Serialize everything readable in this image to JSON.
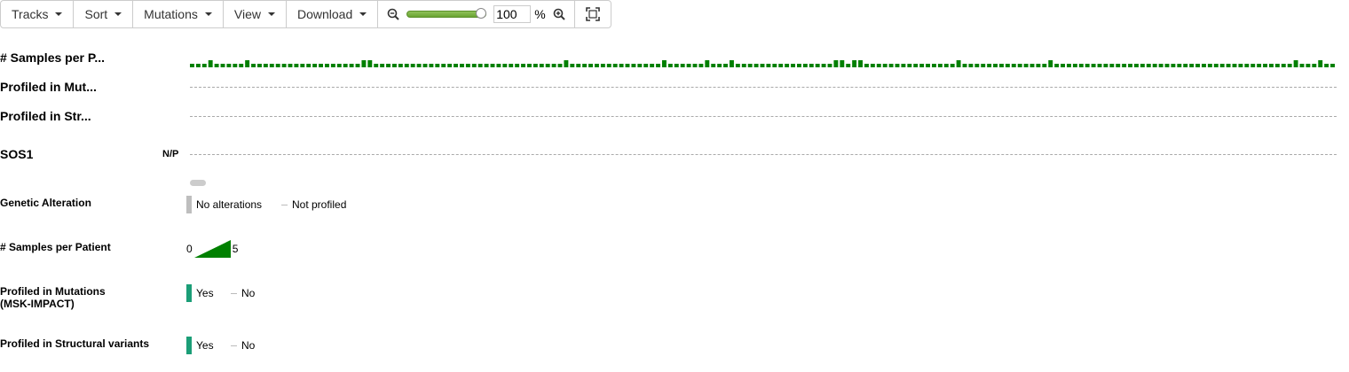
{
  "toolbar": {
    "tracks": "Tracks",
    "sort": "Sort",
    "mutations": "Mutations",
    "view": "View",
    "download": "Download",
    "zoom_value": "100",
    "zoom_unit": "%",
    "zoom_level": 1.0
  },
  "tracks": {
    "samples_per_patient": "# Samples per P...",
    "profiled_mutations": "Profiled in Mut...",
    "profiled_structural": "Profiled in Str...",
    "gene": "SOS1",
    "gene_status": "N/P"
  },
  "samples_per_patient_counts": [
    1,
    1,
    1,
    2,
    1,
    1,
    1,
    1,
    1,
    2,
    1,
    1,
    1,
    1,
    1,
    1,
    1,
    1,
    1,
    1,
    1,
    1,
    1,
    1,
    1,
    1,
    1,
    1,
    2,
    2,
    1,
    1,
    1,
    1,
    1,
    1,
    1,
    1,
    1,
    1,
    1,
    1,
    1,
    1,
    1,
    1,
    1,
    1,
    1,
    1,
    1,
    1,
    1,
    1,
    1,
    1,
    1,
    1,
    1,
    1,
    1,
    2,
    1,
    1,
    1,
    1,
    1,
    1,
    1,
    1,
    1,
    1,
    1,
    1,
    1,
    1,
    1,
    2,
    1,
    1,
    1,
    1,
    1,
    1,
    2,
    1,
    1,
    1,
    2,
    1,
    1,
    1,
    1,
    1,
    1,
    1,
    1,
    1,
    1,
    1,
    1,
    1,
    1,
    1,
    1,
    2,
    2,
    1,
    2,
    2,
    1,
    1,
    1,
    1,
    1,
    1,
    1,
    1,
    1,
    1,
    1,
    1,
    1,
    1,
    1,
    2,
    1,
    1,
    1,
    1,
    1,
    1,
    1,
    1,
    1,
    1,
    1,
    1,
    1,
    1,
    2,
    1,
    1,
    1,
    1,
    1,
    1,
    1,
    1,
    1,
    1,
    1,
    1,
    1,
    1,
    1,
    1,
    1,
    1,
    1,
    1,
    1,
    1,
    1,
    1,
    1,
    1,
    1,
    1,
    1,
    1,
    1,
    1,
    1,
    1,
    1,
    1,
    1,
    1,
    1,
    2,
    1,
    1,
    1,
    2,
    1,
    1
  ],
  "legend": {
    "genetic_alteration": {
      "label": "Genetic Alteration",
      "no_alterations": "No alterations",
      "not_profiled": "Not profiled",
      "no_alt_color": "#bebebe"
    },
    "samples_per_patient": {
      "label": "# Samples per Patient",
      "min": "0",
      "max": "5",
      "color": "#008000"
    },
    "profiled_mutations": {
      "label_line1": "Profiled in Mutations",
      "label_line2": "(MSK-IMPACT)",
      "yes": "Yes",
      "no": "No",
      "color": "#1b9e77"
    },
    "profiled_structural": {
      "label": "Profiled in Structural variants",
      "yes": "Yes",
      "no": "No",
      "color": "#1b9e77"
    }
  }
}
